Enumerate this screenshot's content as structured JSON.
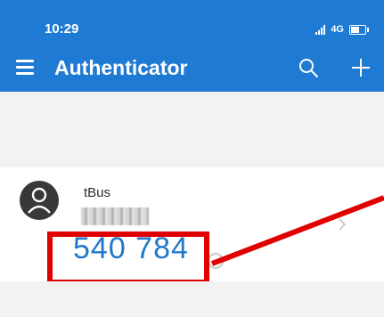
{
  "status_bar": {
    "time": "10:29",
    "network": "4G",
    "icons": [
      "signal-icon",
      "battery-icon"
    ]
  },
  "app_bar": {
    "title": "Authenticator",
    "icons": [
      "menu-icon",
      "search-icon",
      "add-icon"
    ]
  },
  "account": {
    "name": "tBus",
    "code": "540 784",
    "icons": [
      "avatar-icon",
      "timer-icon",
      "chevron-right-icon"
    ]
  },
  "annotation": {
    "highlight_color": "#e00000"
  },
  "colors": {
    "header": "#1f7ad3",
    "code": "#2178c9",
    "background": "#f2f2f2"
  }
}
